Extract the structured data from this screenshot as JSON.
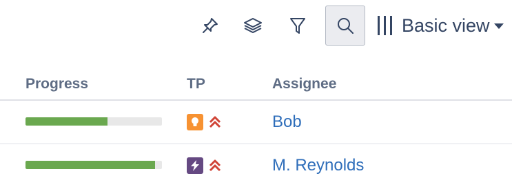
{
  "toolbar": {
    "pin_icon": "pin-icon",
    "layers_icon": "layers-icon",
    "filter_icon": "filter-icon",
    "search_icon": "search-icon",
    "view_label": "Basic view"
  },
  "table": {
    "columns": [
      "Progress",
      "TP",
      "Assignee"
    ],
    "rows": [
      {
        "progress": 0.6,
        "type_icon": "lightbulb-icon",
        "type_color": "#f79232",
        "priority_icon": "highest-priority-icon",
        "assignee": "Bob"
      },
      {
        "progress": 0.95,
        "type_icon": "lightning-icon",
        "type_color": "#654982",
        "priority_icon": "highest-priority-icon",
        "assignee": "M. Reynolds"
      }
    ]
  },
  "colors": {
    "progress_fill": "#6aa84f",
    "progress_track": "#e8e8e8",
    "priority": "#d04437",
    "link": "#2f6eba"
  }
}
